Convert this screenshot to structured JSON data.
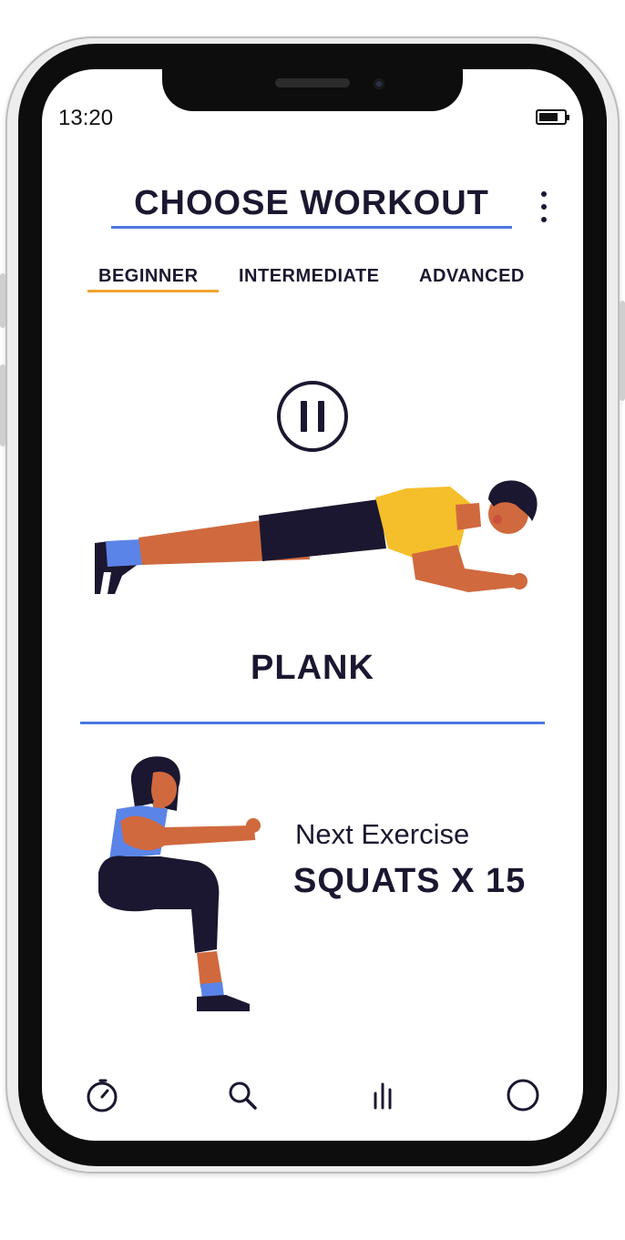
{
  "status_bar": {
    "time": "13:20",
    "battery_icon": "battery-icon"
  },
  "header": {
    "title": "CHOOSE WORKOUT",
    "menu_icon": "more-vertical-icon"
  },
  "tabs": [
    {
      "label": "BEGINNER",
      "selected": true
    },
    {
      "label": "INTERMEDIATE",
      "selected": false
    },
    {
      "label": "ADVANCED",
      "selected": false
    }
  ],
  "current_exercise": {
    "name": "PLANK",
    "control_icon": "pause-icon"
  },
  "next": {
    "label": "Next Exercise",
    "exercise": "SQUATS X 15"
  },
  "bottom_nav": [
    {
      "icon": "timer-icon"
    },
    {
      "icon": "search-icon"
    },
    {
      "icon": "stats-icon"
    },
    {
      "icon": "profile-circle-icon"
    }
  ],
  "colors": {
    "accent_blue": "#4b78e0",
    "tab_underline_orange": "#f0a431",
    "text_dark": "#1c1730",
    "shirt_yellow": "#f4bf2a",
    "skin": "#d0693e",
    "top_blue": "#5b84e8"
  }
}
